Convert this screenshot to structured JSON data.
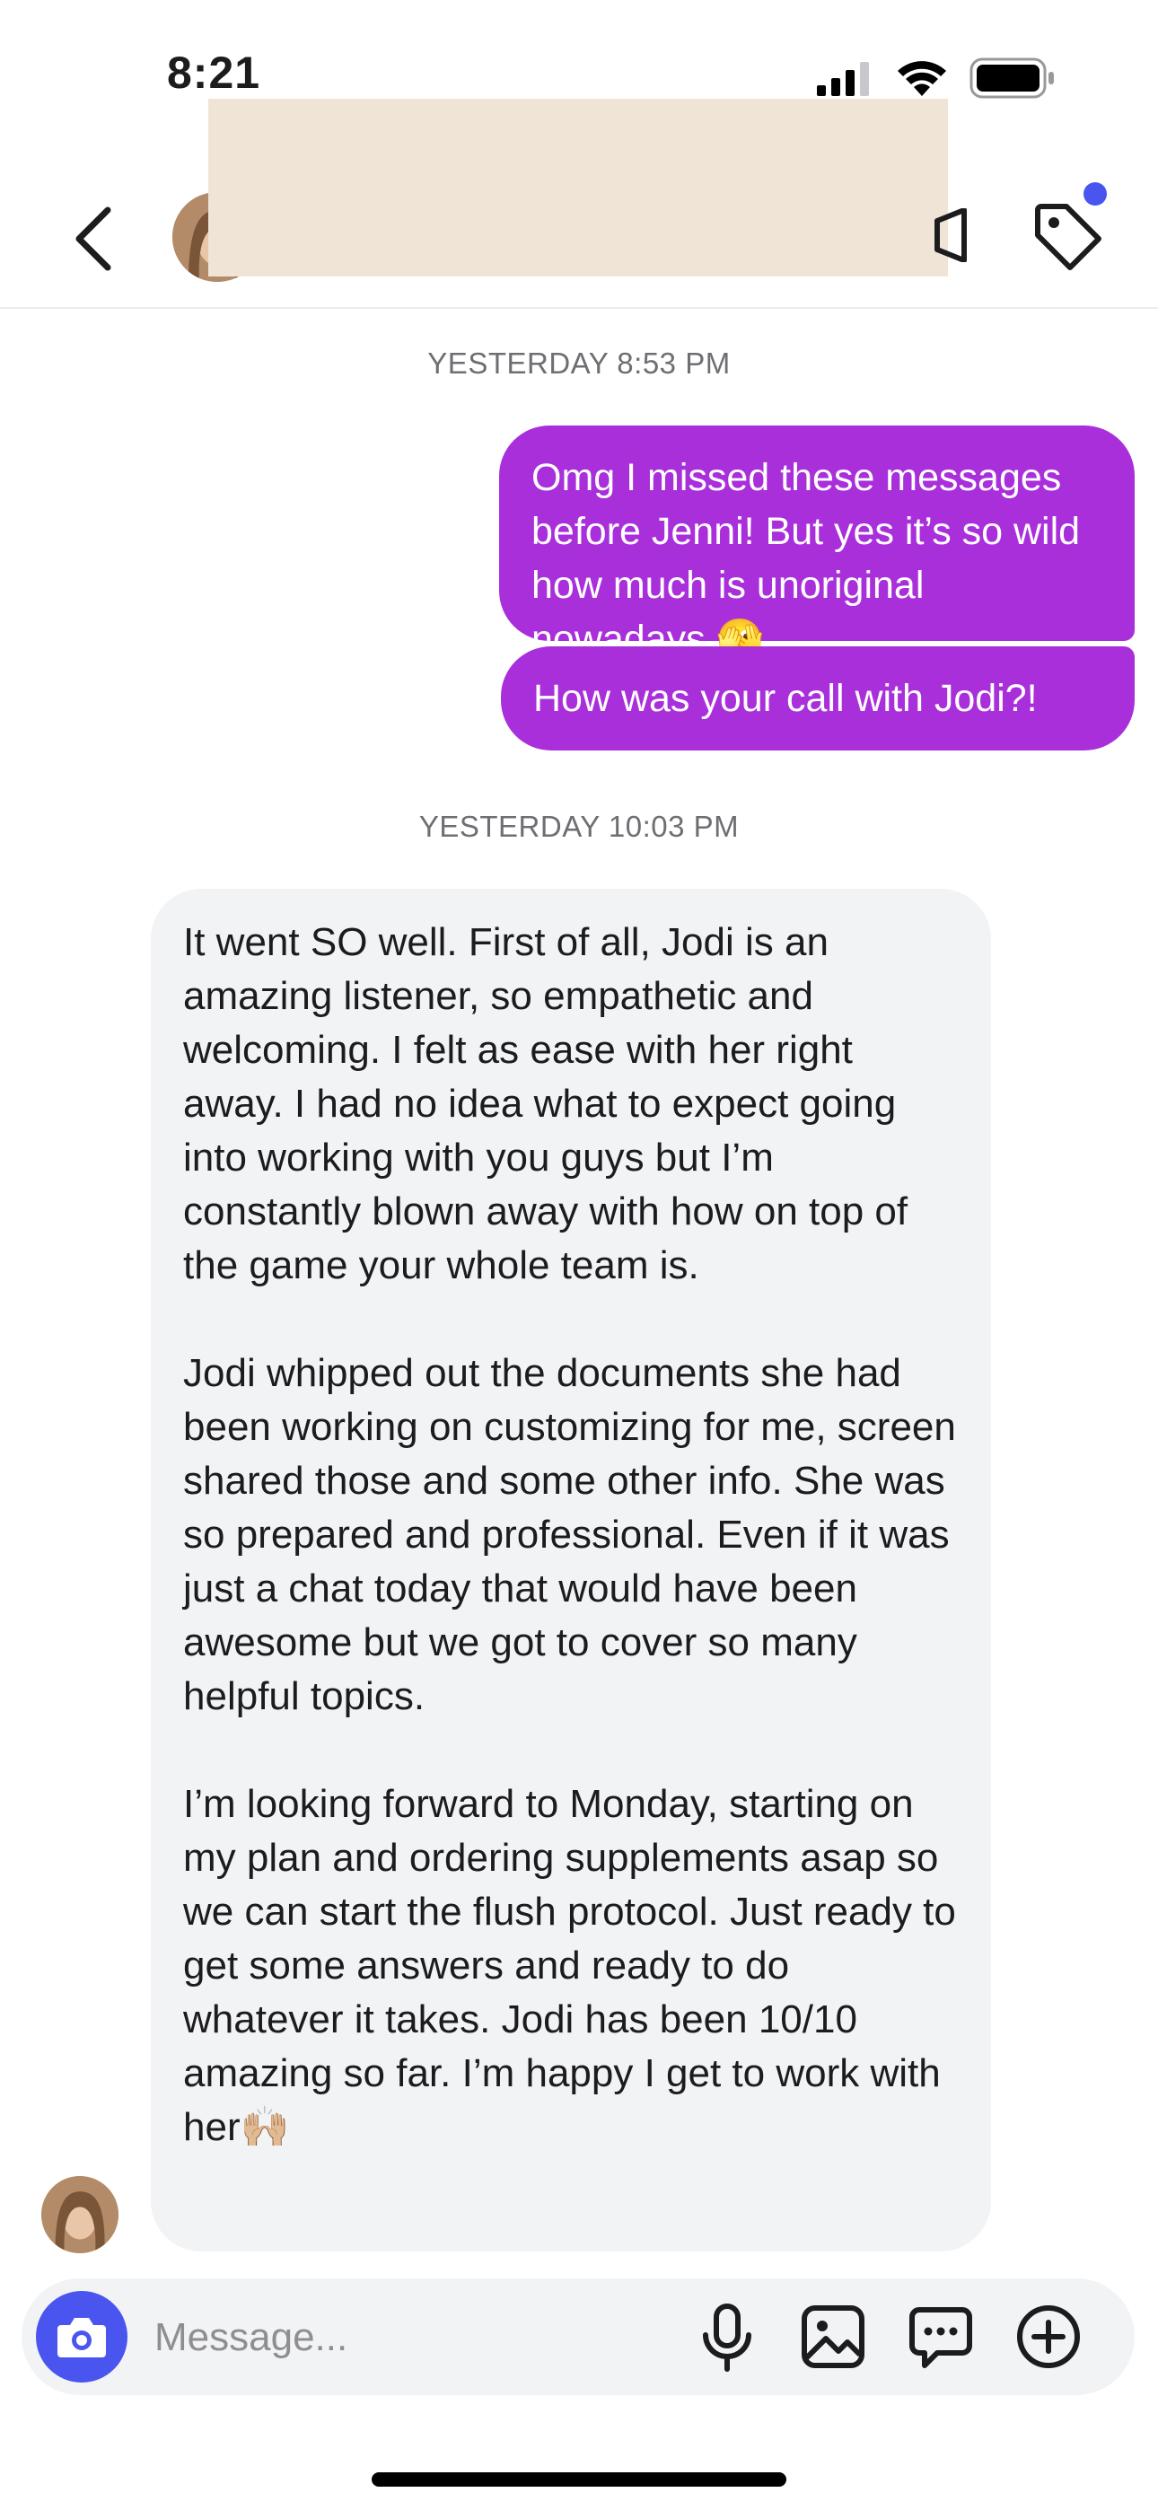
{
  "status_bar": {
    "time": "8:21"
  },
  "header": {
    "back_icon": "chevron-left-icon",
    "tag_icon": "tag-icon",
    "video_icon": "video-camera-icon",
    "notification_color": "#4a55f0"
  },
  "thread": {
    "timestamp_1": "YESTERDAY 8:53 PM",
    "outgoing": [
      "Omg I missed these messages before Jenni! But yes it’s so wild how much is unoriginal nowadays 🫣",
      "How was your call with Jodi?!"
    ],
    "timestamp_2": "YESTERDAY 10:03 PM",
    "incoming_paragraphs": [
      "It went SO well. First of all, Jodi is an amazing listener, so empathetic and welcoming. I felt as ease with her right away. I had no idea what to expect going into working with you guys but I’m constantly blown away with how on top of the game your whole team is.",
      "Jodi whipped out the documents she had been working on customizing for me, screen shared those and some other info. She was so prepared and professional. Even if it was just a chat today that would have been awesome but we got to cover so many helpful topics.",
      "I’m looking forward to Monday, starting on my plan and ordering supplements asap so we can start the flush protocol. Just ready to get some answers and ready to do whatever it takes. Jodi has been 10/10 amazing so far. I’m happy I get to work with her🙌🏼"
    ],
    "outgoing_bubble_color": "#a92fdb",
    "incoming_bubble_color": "#f2f3f5"
  },
  "composer": {
    "placeholder": "Message...",
    "icons": [
      "camera-icon",
      "microphone-icon",
      "image-icon",
      "chat-bubble-icon",
      "plus-circle-icon"
    ],
    "accent": "#4a55f0"
  }
}
